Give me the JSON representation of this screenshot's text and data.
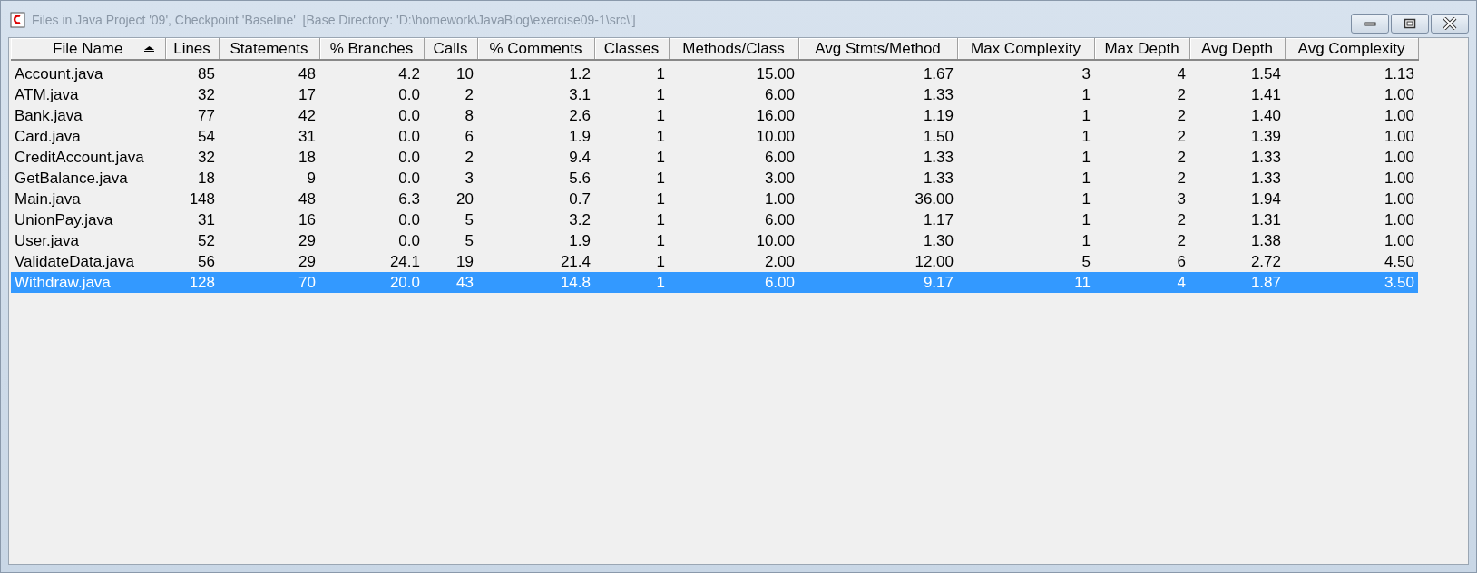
{
  "window": {
    "title": "Files in Java Project '09', Checkpoint 'Baseline'  [Base Directory: 'D:\\homework\\JavaBlog\\exercise09-1\\src\\']"
  },
  "table": {
    "columns": [
      {
        "label": "File Name",
        "sorted": true
      },
      {
        "label": "Lines",
        "sorted": false
      },
      {
        "label": "Statements",
        "sorted": false
      },
      {
        "label": "% Branches",
        "sorted": false
      },
      {
        "label": "Calls",
        "sorted": false
      },
      {
        "label": "% Comments",
        "sorted": false
      },
      {
        "label": "Classes",
        "sorted": false
      },
      {
        "label": "Methods/Class",
        "sorted": false
      },
      {
        "label": "Avg Stmts/Method",
        "sorted": false
      },
      {
        "label": "Max Complexity",
        "sorted": false
      },
      {
        "label": "Max Depth",
        "sorted": false
      },
      {
        "label": "Avg Depth",
        "sorted": false
      },
      {
        "label": "Avg Complexity",
        "sorted": false
      }
    ],
    "rows": [
      {
        "selected": false,
        "cells": [
          "Account.java",
          "85",
          "48",
          "4.2",
          "10",
          "1.2",
          "1",
          "15.00",
          "1.67",
          "3",
          "4",
          "1.54",
          "1.13"
        ]
      },
      {
        "selected": false,
        "cells": [
          "ATM.java",
          "32",
          "17",
          "0.0",
          "2",
          "3.1",
          "1",
          "6.00",
          "1.33",
          "1",
          "2",
          "1.41",
          "1.00"
        ]
      },
      {
        "selected": false,
        "cells": [
          "Bank.java",
          "77",
          "42",
          "0.0",
          "8",
          "2.6",
          "1",
          "16.00",
          "1.19",
          "1",
          "2",
          "1.40",
          "1.00"
        ]
      },
      {
        "selected": false,
        "cells": [
          "Card.java",
          "54",
          "31",
          "0.0",
          "6",
          "1.9",
          "1",
          "10.00",
          "1.50",
          "1",
          "2",
          "1.39",
          "1.00"
        ]
      },
      {
        "selected": false,
        "cells": [
          "CreditAccount.java",
          "32",
          "18",
          "0.0",
          "2",
          "9.4",
          "1",
          "6.00",
          "1.33",
          "1",
          "2",
          "1.33",
          "1.00"
        ]
      },
      {
        "selected": false,
        "cells": [
          "GetBalance.java",
          "18",
          "9",
          "0.0",
          "3",
          "5.6",
          "1",
          "3.00",
          "1.33",
          "1",
          "2",
          "1.33",
          "1.00"
        ]
      },
      {
        "selected": false,
        "cells": [
          "Main.java",
          "148",
          "48",
          "6.3",
          "20",
          "0.7",
          "1",
          "1.00",
          "36.00",
          "1",
          "3",
          "1.94",
          "1.00"
        ]
      },
      {
        "selected": false,
        "cells": [
          "UnionPay.java",
          "31",
          "16",
          "0.0",
          "5",
          "3.2",
          "1",
          "6.00",
          "1.17",
          "1",
          "2",
          "1.31",
          "1.00"
        ]
      },
      {
        "selected": false,
        "cells": [
          "User.java",
          "52",
          "29",
          "0.0",
          "5",
          "1.9",
          "1",
          "10.00",
          "1.30",
          "1",
          "2",
          "1.38",
          "1.00"
        ]
      },
      {
        "selected": false,
        "cells": [
          "ValidateData.java",
          "56",
          "29",
          "24.1",
          "19",
          "21.4",
          "1",
          "2.00",
          "12.00",
          "5",
          "6",
          "2.72",
          "4.50"
        ]
      },
      {
        "selected": true,
        "cells": [
          "Withdraw.java",
          "128",
          "70",
          "20.0",
          "43",
          "14.8",
          "1",
          "6.00",
          "9.17",
          "11",
          "4",
          "1.87",
          "3.50"
        ]
      }
    ]
  }
}
